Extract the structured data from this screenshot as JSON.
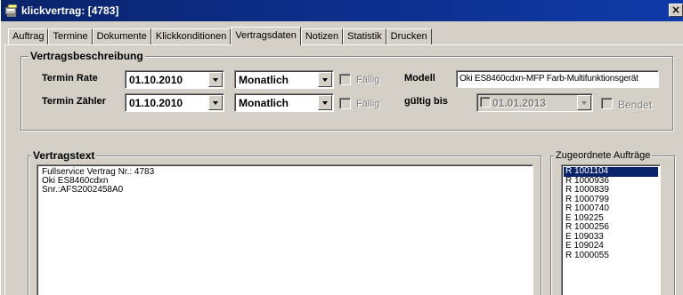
{
  "window": {
    "title": "klickvertrag: [4783]",
    "close_glyph": "×"
  },
  "tabs": [
    {
      "label": "Auftrag",
      "active": false
    },
    {
      "label": "Termine",
      "active": false
    },
    {
      "label": "Dokumente",
      "active": false
    },
    {
      "label": "Klickkonditionen",
      "active": false
    },
    {
      "label": "Vertragsdaten",
      "active": true
    },
    {
      "label": "Notizen",
      "active": false
    },
    {
      "label": "Statistik",
      "active": false
    },
    {
      "label": "Drucken",
      "active": false
    }
  ],
  "vertragsbeschreibung": {
    "title": "Vertragsbeschreibung",
    "termin_rate": {
      "label": "Termin Rate",
      "date": "01.10.2010",
      "interval": "Monatlich",
      "faellig_label": "Fällig"
    },
    "termin_zaehler": {
      "label": "Termin Zähler",
      "date": "01.10.2010",
      "interval": "Monatlich",
      "faellig_label": "Fällig"
    },
    "modell": {
      "label": "Modell",
      "value": "Oki ES8460cdxn-MFP Farb-Multifunktionsgerät"
    },
    "gueltig_bis": {
      "label": "gültig bis",
      "date": "01.01.2013",
      "beendet_label": "Bendet"
    }
  },
  "vertragstext": {
    "title": "Vertragstext",
    "lines": [
      "Fullservice Vertrag Nr.: 4783",
      "Oki ES8460cdxn",
      "Snr.:AFS2002458A0"
    ]
  },
  "auftraege": {
    "title": "Zugeordnete Aufträge",
    "items": [
      "R 1001104",
      "R 1000936",
      "R 1000839",
      "R 1000799",
      "R 1000740",
      "E 109225",
      "R 1000256",
      "E 109033",
      "E 109024",
      "R 1000055"
    ],
    "selected_index": 0
  },
  "colors": {
    "titlebar": "#0a246a",
    "face": "#d4d0c8",
    "selection": "#0a246a"
  }
}
